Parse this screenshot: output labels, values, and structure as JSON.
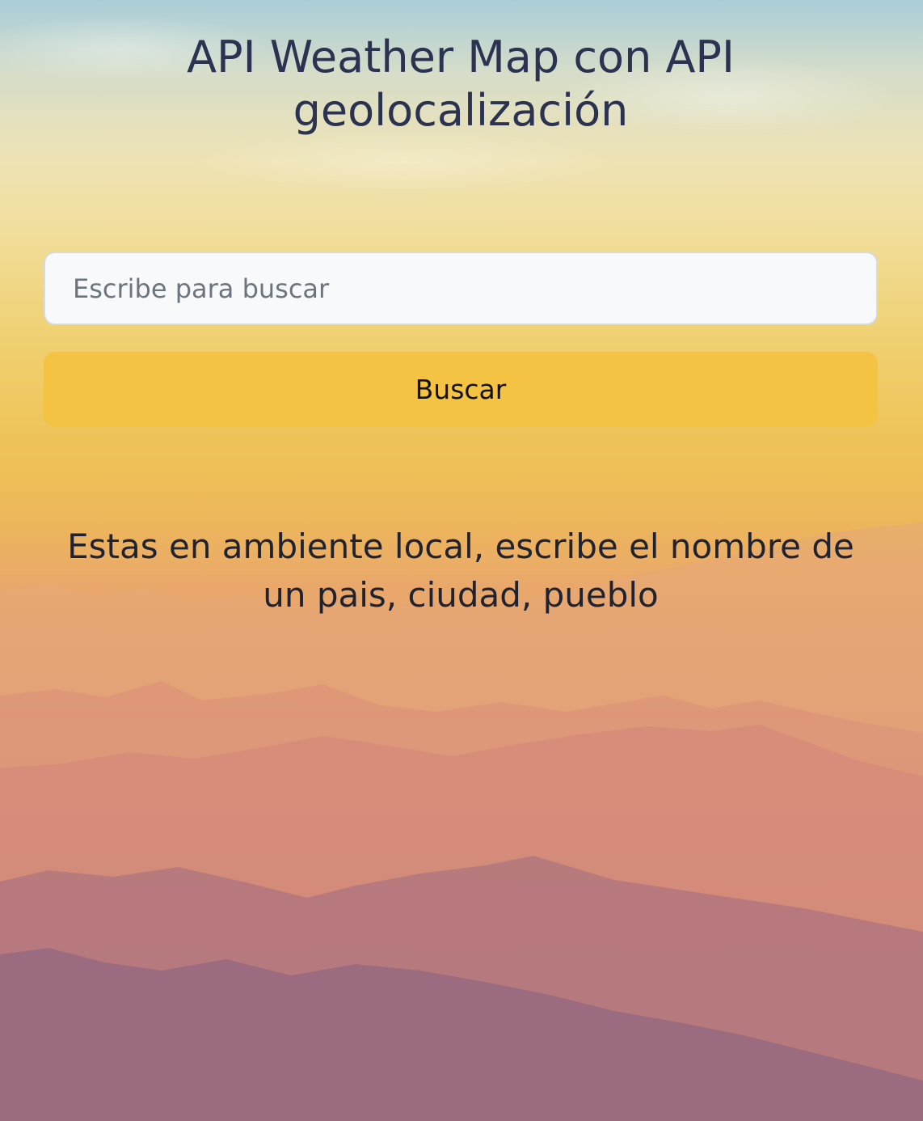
{
  "header": {
    "title": "API Weather Map con API geolocalización"
  },
  "search": {
    "placeholder": "Escribe para buscar",
    "value": "",
    "button_label": "Buscar"
  },
  "status": {
    "message": "Estas en ambiente local, escribe el nombre de un pais, ciudad, pueblo"
  },
  "colors": {
    "title_text": "#2b3350",
    "button_background": "#f5c343",
    "input_background": "#f8f9fa",
    "message_text": "#1f2230"
  },
  "background": {
    "image": "mountain-sunset-landscape"
  }
}
